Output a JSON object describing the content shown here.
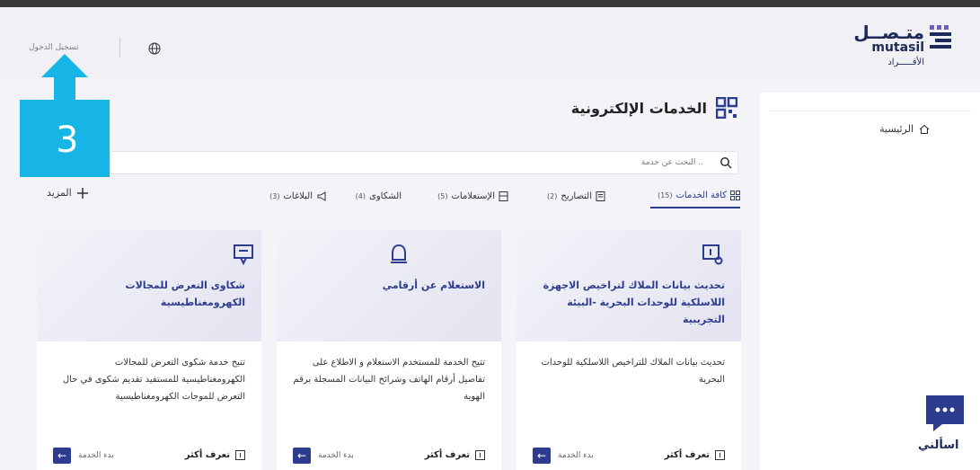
{
  "header": {
    "logo_ar": "متـصــل",
    "logo_en": "mutasil",
    "logo_sub": "الأفـــــراد",
    "login_label": "تسجيل الدخول"
  },
  "sidebar": {
    "home_label": "الرئيسية"
  },
  "main": {
    "title": "الخدمات الإلكترونية",
    "search_placeholder": "البحث عن خدمة ..",
    "more_label": "المزيد",
    "tabs": [
      {
        "label": "كافة الخدمات",
        "count": "(15)"
      },
      {
        "label": "التصاريح",
        "count": "(2)"
      },
      {
        "label": "الإستعلامات",
        "count": "(5)"
      },
      {
        "label": "الشكاوى",
        "count": "(4)"
      },
      {
        "label": "البلاغات",
        "count": "(3)"
      }
    ]
  },
  "cards": [
    {
      "title": "تحديث بيانات الملاك لتراخيص الاجهزة اللاسلكية للوحدات البحرية -البيئة التجريبية",
      "desc": "تحديث بيانات الملاك للتراخيص اللاسلكية للوحدات البحرية",
      "learn": "تعرف أكثر",
      "start": "بدء الخدمة"
    },
    {
      "title": "الاستعلام عن أرقامي",
      "desc": "تتيح الخدمة للمستخدم الاستعلام و الاطلاع على تفاصيل أرقام الهاتف وشرائح البيانات المسجلة برقم الهوية",
      "learn": "تعرف أكثر",
      "start": "بدء الخدمة"
    },
    {
      "title": "شكاوى التعرض للمجالات الكهرومغناطيسية",
      "desc": "تتيح خدمة شكوى التعرض للمجالات الكهرومغناطيسية للمستفيد تقديم شكوى في حال التعرض للموجات الكهرومغناطيسية",
      "learn": "تعرف أكثر",
      "start": "بدء الخدمة"
    }
  ],
  "callout": {
    "number": "3"
  },
  "chat": {
    "label": "اسألني"
  },
  "colors": {
    "primary": "#2d3c8f",
    "callout": "#16b5e6",
    "header_bg": "#f1f1f5"
  },
  "icons": [
    "globe-icon",
    "home-icon",
    "grid-icon",
    "search-icon",
    "plus-icon",
    "chat-icon"
  ]
}
